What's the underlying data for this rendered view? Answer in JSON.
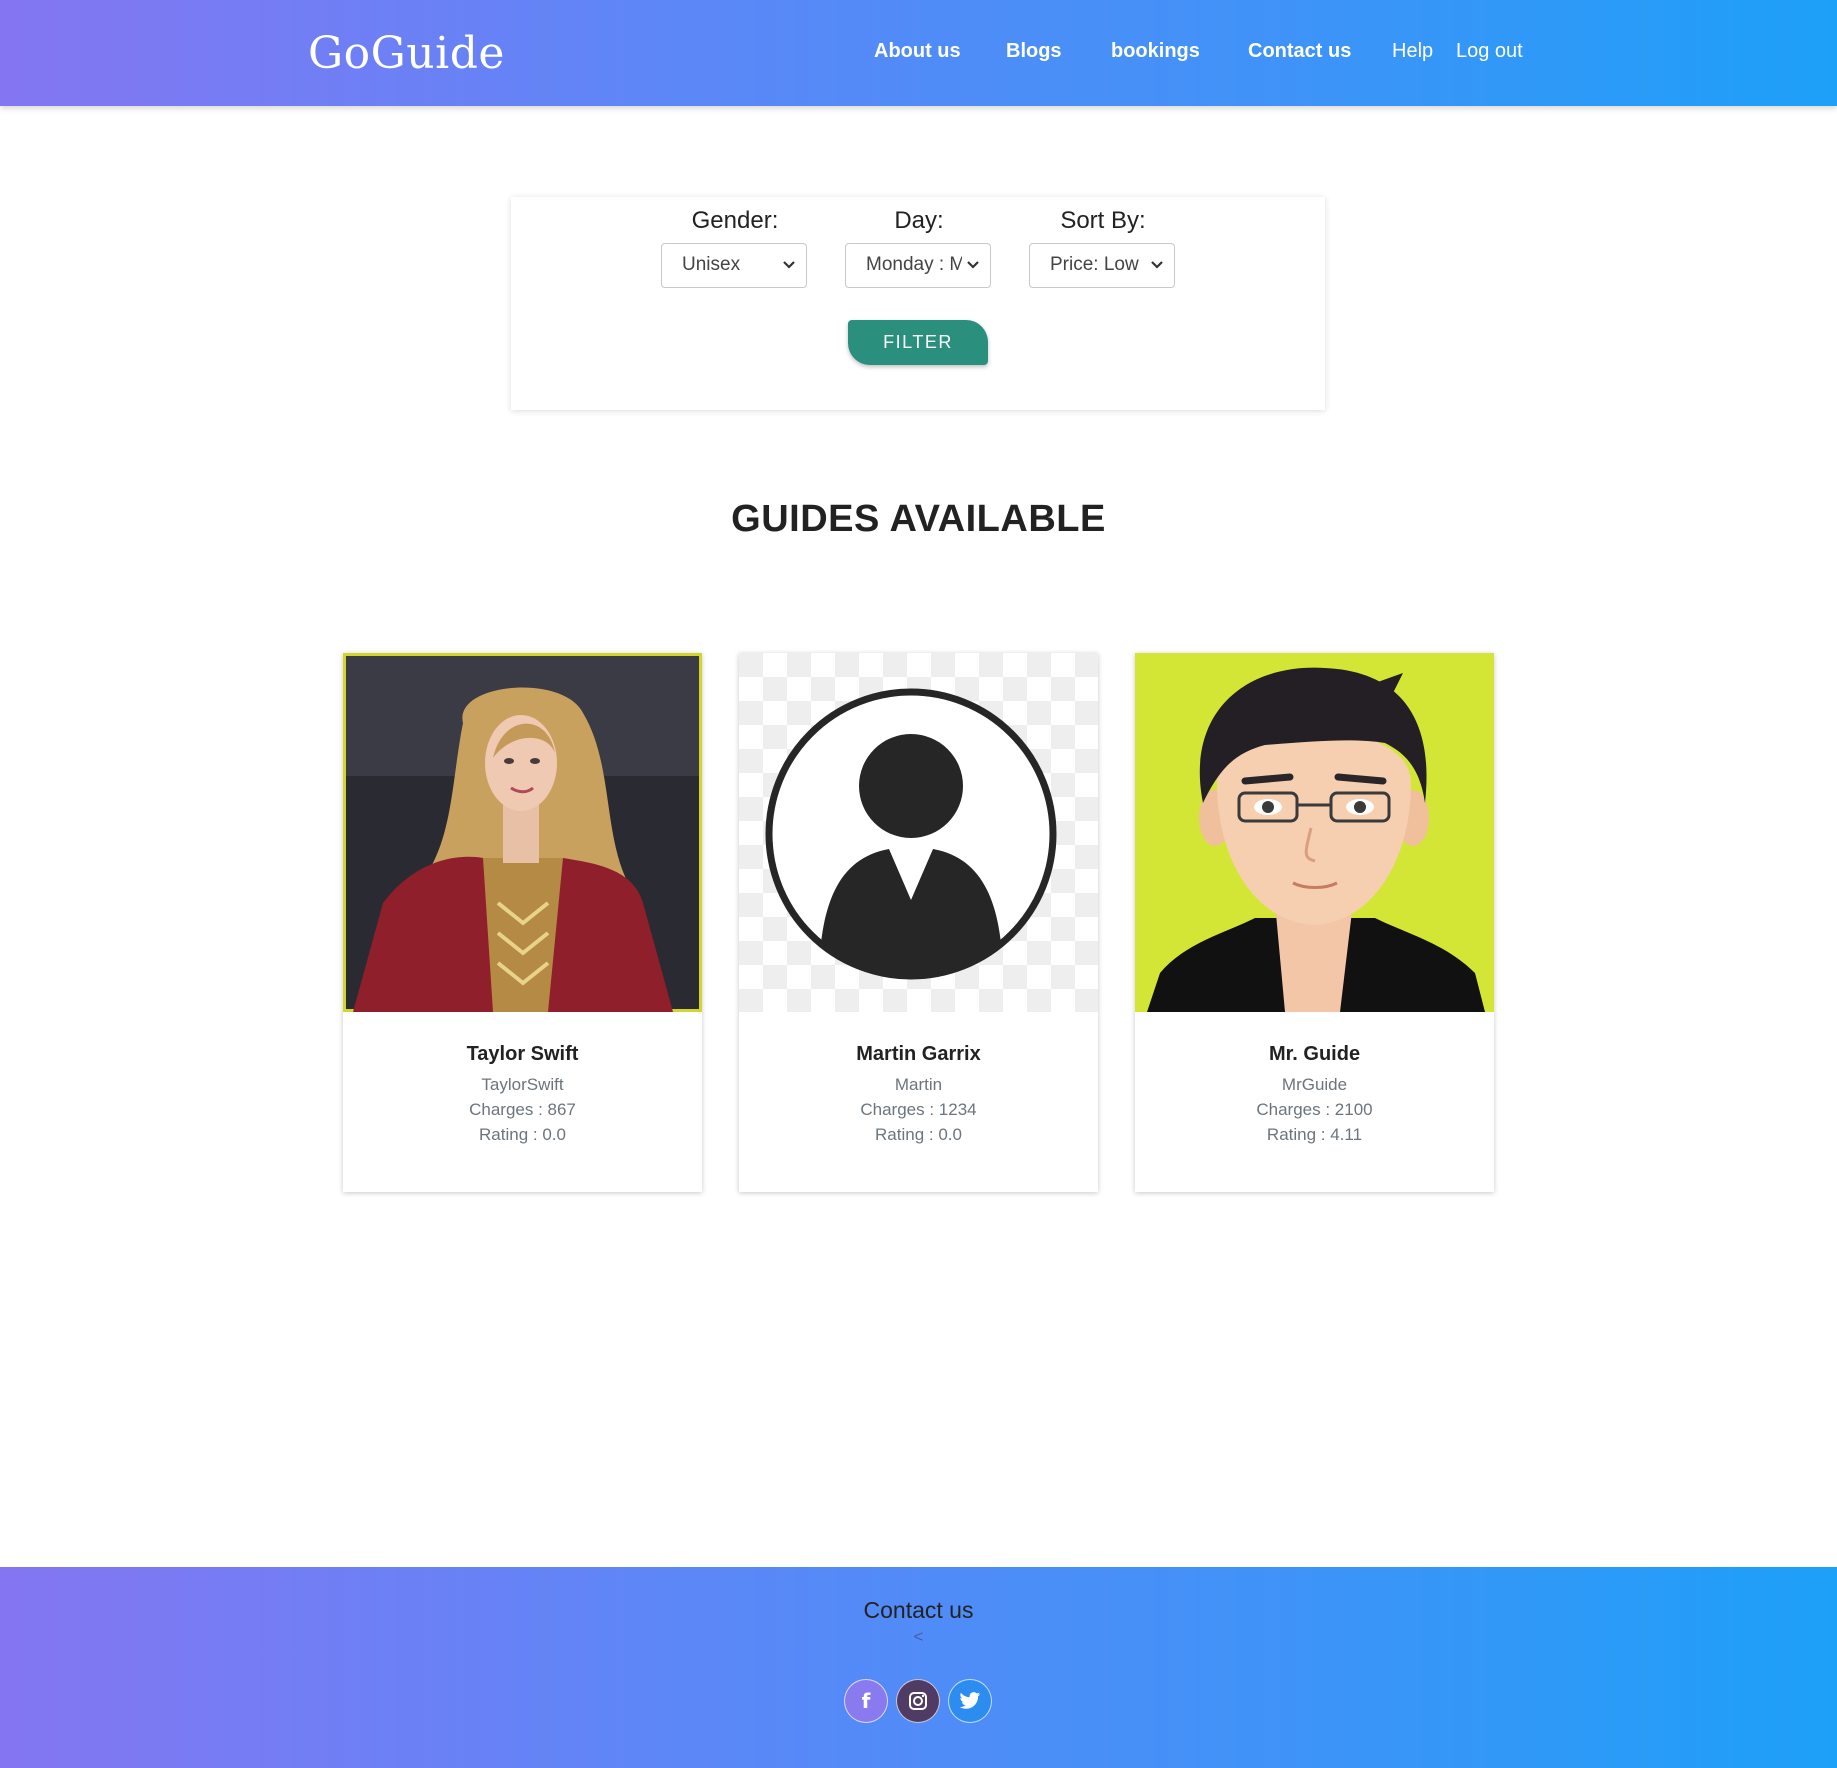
{
  "brand": "GoGuide",
  "nav": {
    "about": "About us",
    "blogs": "Blogs",
    "bookings": "bookings",
    "contact": "Contact us",
    "help": "Help",
    "logout": "Log out"
  },
  "filter": {
    "gender_label": "Gender:",
    "gender_value": "Unisex",
    "day_label": "Day:",
    "day_value": "Monday : M",
    "sort_label": "Sort By:",
    "sort_value": "Price: Low",
    "button": "FILTER"
  },
  "heading": "GUIDES AVAILABLE",
  "guides": [
    {
      "name": "Taylor Swift",
      "username": "TaylorSwift",
      "charges": "Charges : 867",
      "rating": "Rating : 0.0"
    },
    {
      "name": "Martin Garrix",
      "username": "Martin",
      "charges": "Charges : 1234",
      "rating": "Rating : 0.0"
    },
    {
      "name": "Mr. Guide",
      "username": "MrGuide",
      "charges": "Charges : 2100",
      "rating": "Rating : 4.11"
    }
  ],
  "footer": {
    "title": "Contact us",
    "arrow": "<",
    "social": [
      {
        "icon": "facebook-icon",
        "glyph": "f"
      },
      {
        "icon": "instagram-icon",
        "glyph": ""
      },
      {
        "icon": "twitter-icon",
        "glyph": ""
      }
    ]
  },
  "colors": {
    "gradient_start": "#8476f2",
    "gradient_end": "#1da0f8",
    "filter_button": "#2b8f7e",
    "muted_text": "#6c757d"
  }
}
